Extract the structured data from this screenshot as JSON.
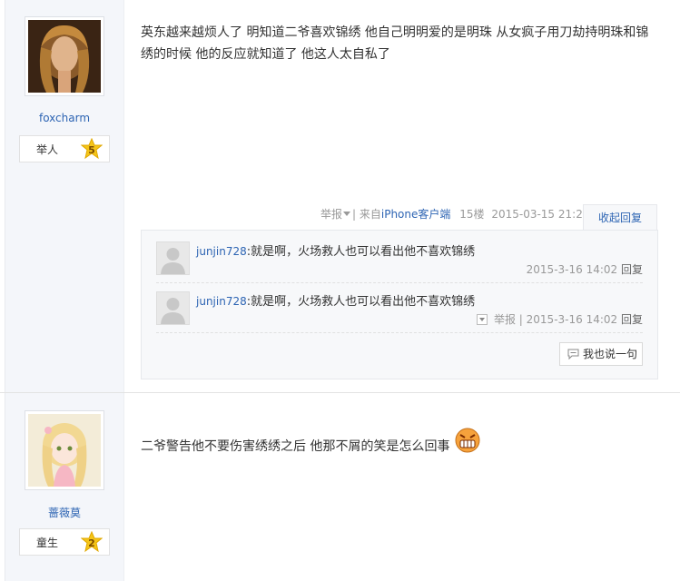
{
  "posts": [
    {
      "username": "foxcharm",
      "level_title": "举人",
      "level": "5",
      "content": "英东越来越烦人了 明知道二爷喜欢锦绣 他自己明明爱的是明珠 从女疯子用刀劫持明珠和锦绣的时候 他的反应就知道了 他这人太自私了",
      "meta": {
        "report": "举报",
        "source_prefix": "| 来自",
        "source": "iPhone客户端",
        "floor": "15楼",
        "time": "2015-03-15 21:20"
      },
      "reply_toggle": "收起回复",
      "replies": [
        {
          "user": "junjin728",
          "text": ":就是啊，火场救人也可以看出他不喜欢锦绣",
          "time": "2015-3-16 14:02",
          "reply_link": "回复"
        },
        {
          "user": "junjin728",
          "text": ":就是啊，火场救人也可以看出他不喜欢锦绣",
          "report": "举报 |",
          "time": "2015-3-16 14:02",
          "reply_link": "回复"
        }
      ],
      "say_button": "我也说一句"
    },
    {
      "username": "蔷薇莫",
      "level_title": "童生",
      "level": "2",
      "content": "二爷警告他不要伤害绣绣之后 他那不屑的笑是怎么回事"
    }
  ],
  "icons": {
    "level_badge": "star-badge-icon",
    "dropdown": "chevron-down-icon",
    "comment": "comment-bubble-icon",
    "emoji": "angry-grin-emoji-icon"
  },
  "colors": {
    "link": "#2d64b3",
    "sidebar_bg": "#f4f6fa",
    "badge": "#f5c518"
  }
}
